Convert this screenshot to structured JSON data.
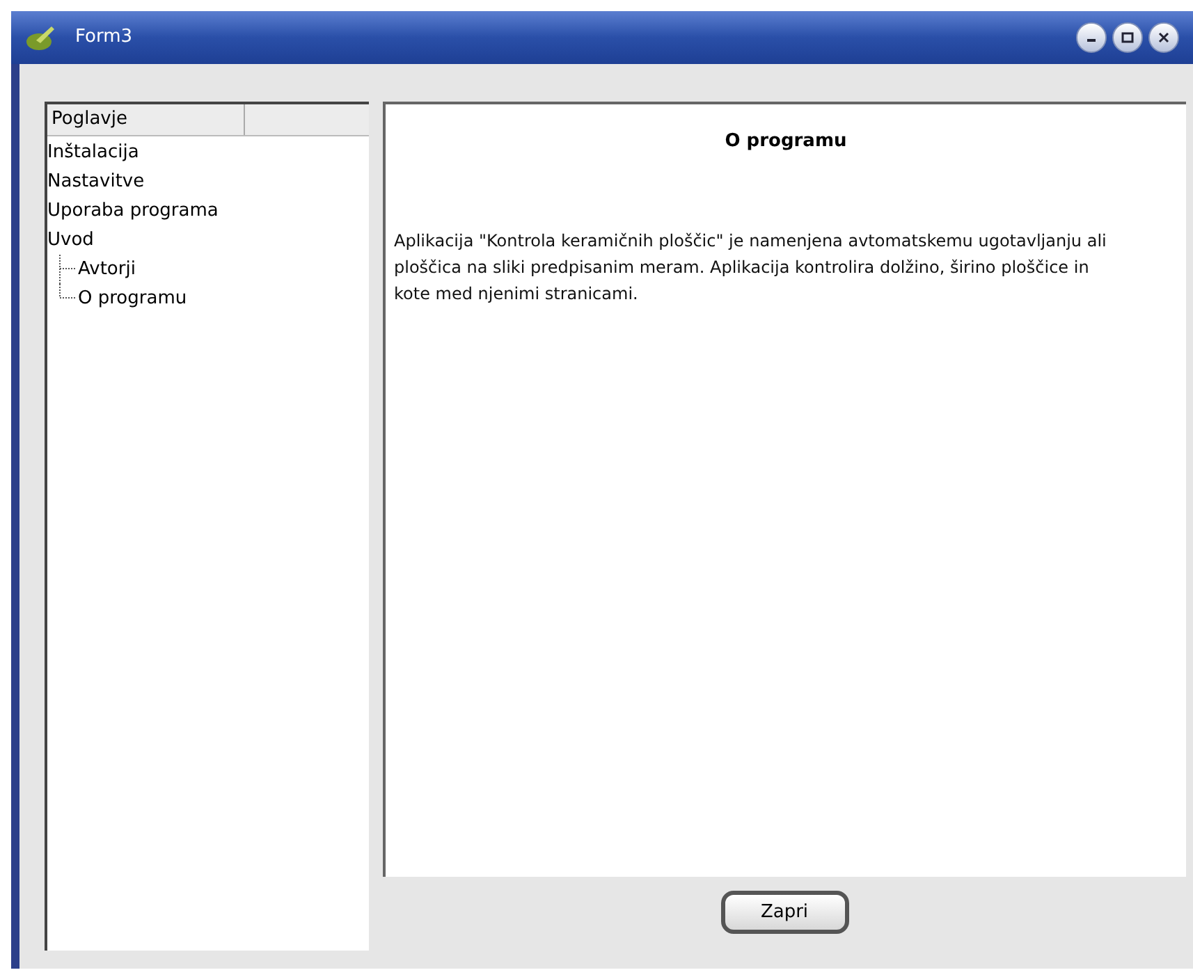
{
  "window": {
    "title": "Form3"
  },
  "tree": {
    "column_header": "Poglavje",
    "items": [
      {
        "label": "Inštalacija"
      },
      {
        "label": "Nastavitve"
      },
      {
        "label": "Uporaba programa"
      },
      {
        "label": "Uvod",
        "children": [
          {
            "label": "Avtorji"
          },
          {
            "label": "O programu"
          }
        ]
      }
    ]
  },
  "content": {
    "heading": "O programu",
    "text": "Aplikacija \"Kontrola keramičnih ploščic\" je namenjena avtomatskemu ugotavljanju ali ploščica na sliki predpisanim meram. Aplikacija kontrolira dolžino, širino ploščice in kote med njenimi stranicami."
  },
  "buttons": [
    {
      "label": "Zapri"
    }
  ]
}
